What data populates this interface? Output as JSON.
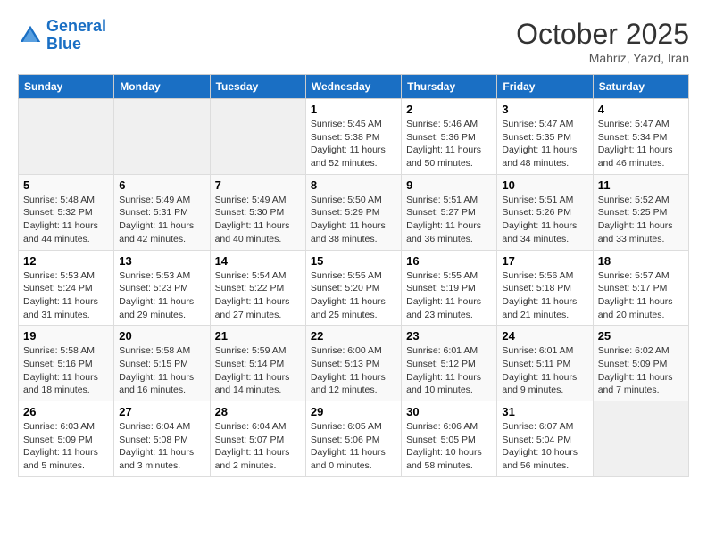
{
  "header": {
    "logo_line1": "General",
    "logo_line2": "Blue",
    "month_title": "October 2025",
    "subtitle": "Mahriz, Yazd, Iran"
  },
  "days_of_week": [
    "Sunday",
    "Monday",
    "Tuesday",
    "Wednesday",
    "Thursday",
    "Friday",
    "Saturday"
  ],
  "weeks": [
    [
      {
        "day": "",
        "info": ""
      },
      {
        "day": "",
        "info": ""
      },
      {
        "day": "",
        "info": ""
      },
      {
        "day": "1",
        "info": "Sunrise: 5:45 AM\nSunset: 5:38 PM\nDaylight: 11 hours\nand 52 minutes."
      },
      {
        "day": "2",
        "info": "Sunrise: 5:46 AM\nSunset: 5:36 PM\nDaylight: 11 hours\nand 50 minutes."
      },
      {
        "day": "3",
        "info": "Sunrise: 5:47 AM\nSunset: 5:35 PM\nDaylight: 11 hours\nand 48 minutes."
      },
      {
        "day": "4",
        "info": "Sunrise: 5:47 AM\nSunset: 5:34 PM\nDaylight: 11 hours\nand 46 minutes."
      }
    ],
    [
      {
        "day": "5",
        "info": "Sunrise: 5:48 AM\nSunset: 5:32 PM\nDaylight: 11 hours\nand 44 minutes."
      },
      {
        "day": "6",
        "info": "Sunrise: 5:49 AM\nSunset: 5:31 PM\nDaylight: 11 hours\nand 42 minutes."
      },
      {
        "day": "7",
        "info": "Sunrise: 5:49 AM\nSunset: 5:30 PM\nDaylight: 11 hours\nand 40 minutes."
      },
      {
        "day": "8",
        "info": "Sunrise: 5:50 AM\nSunset: 5:29 PM\nDaylight: 11 hours\nand 38 minutes."
      },
      {
        "day": "9",
        "info": "Sunrise: 5:51 AM\nSunset: 5:27 PM\nDaylight: 11 hours\nand 36 minutes."
      },
      {
        "day": "10",
        "info": "Sunrise: 5:51 AM\nSunset: 5:26 PM\nDaylight: 11 hours\nand 34 minutes."
      },
      {
        "day": "11",
        "info": "Sunrise: 5:52 AM\nSunset: 5:25 PM\nDaylight: 11 hours\nand 33 minutes."
      }
    ],
    [
      {
        "day": "12",
        "info": "Sunrise: 5:53 AM\nSunset: 5:24 PM\nDaylight: 11 hours\nand 31 minutes."
      },
      {
        "day": "13",
        "info": "Sunrise: 5:53 AM\nSunset: 5:23 PM\nDaylight: 11 hours\nand 29 minutes."
      },
      {
        "day": "14",
        "info": "Sunrise: 5:54 AM\nSunset: 5:22 PM\nDaylight: 11 hours\nand 27 minutes."
      },
      {
        "day": "15",
        "info": "Sunrise: 5:55 AM\nSunset: 5:20 PM\nDaylight: 11 hours\nand 25 minutes."
      },
      {
        "day": "16",
        "info": "Sunrise: 5:55 AM\nSunset: 5:19 PM\nDaylight: 11 hours\nand 23 minutes."
      },
      {
        "day": "17",
        "info": "Sunrise: 5:56 AM\nSunset: 5:18 PM\nDaylight: 11 hours\nand 21 minutes."
      },
      {
        "day": "18",
        "info": "Sunrise: 5:57 AM\nSunset: 5:17 PM\nDaylight: 11 hours\nand 20 minutes."
      }
    ],
    [
      {
        "day": "19",
        "info": "Sunrise: 5:58 AM\nSunset: 5:16 PM\nDaylight: 11 hours\nand 18 minutes."
      },
      {
        "day": "20",
        "info": "Sunrise: 5:58 AM\nSunset: 5:15 PM\nDaylight: 11 hours\nand 16 minutes."
      },
      {
        "day": "21",
        "info": "Sunrise: 5:59 AM\nSunset: 5:14 PM\nDaylight: 11 hours\nand 14 minutes."
      },
      {
        "day": "22",
        "info": "Sunrise: 6:00 AM\nSunset: 5:13 PM\nDaylight: 11 hours\nand 12 minutes."
      },
      {
        "day": "23",
        "info": "Sunrise: 6:01 AM\nSunset: 5:12 PM\nDaylight: 11 hours\nand 10 minutes."
      },
      {
        "day": "24",
        "info": "Sunrise: 6:01 AM\nSunset: 5:11 PM\nDaylight: 11 hours\nand 9 minutes."
      },
      {
        "day": "25",
        "info": "Sunrise: 6:02 AM\nSunset: 5:09 PM\nDaylight: 11 hours\nand 7 minutes."
      }
    ],
    [
      {
        "day": "26",
        "info": "Sunrise: 6:03 AM\nSunset: 5:09 PM\nDaylight: 11 hours\nand 5 minutes."
      },
      {
        "day": "27",
        "info": "Sunrise: 6:04 AM\nSunset: 5:08 PM\nDaylight: 11 hours\nand 3 minutes."
      },
      {
        "day": "28",
        "info": "Sunrise: 6:04 AM\nSunset: 5:07 PM\nDaylight: 11 hours\nand 2 minutes."
      },
      {
        "day": "29",
        "info": "Sunrise: 6:05 AM\nSunset: 5:06 PM\nDaylight: 11 hours\nand 0 minutes."
      },
      {
        "day": "30",
        "info": "Sunrise: 6:06 AM\nSunset: 5:05 PM\nDaylight: 10 hours\nand 58 minutes."
      },
      {
        "day": "31",
        "info": "Sunrise: 6:07 AM\nSunset: 5:04 PM\nDaylight: 10 hours\nand 56 minutes."
      },
      {
        "day": "",
        "info": ""
      }
    ]
  ]
}
